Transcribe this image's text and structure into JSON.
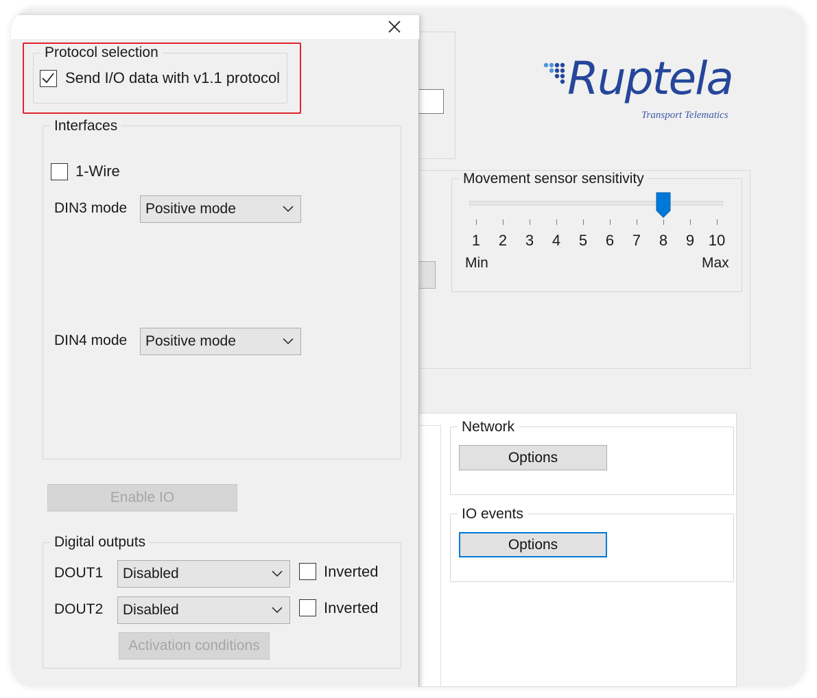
{
  "dialog": {
    "protocol_group": {
      "legend": "Protocol selection",
      "checkbox_label": "Send I/O data with v1.1 protocol",
      "checked": true
    },
    "interfaces_group": {
      "legend": "Interfaces",
      "onewire_label": "1-Wire",
      "onewire_checked": false,
      "din3_label": "DIN3 mode",
      "din3_value": "Positive mode",
      "din4_label": "DIN4 mode",
      "din4_value": "Positive mode"
    },
    "enable_io_label": "Enable IO",
    "digital_outputs_group": {
      "legend": "Digital outputs",
      "dout1_label": "DOUT1",
      "dout1_value": "Disabled",
      "dout1_inverted_label": "Inverted",
      "dout2_label": "DOUT2",
      "dout2_value": "Disabled",
      "dout2_inverted_label": "Inverted",
      "activation_label": "Activation conditions"
    }
  },
  "main": {
    "logo": {
      "name": "Ruptela",
      "tagline": "Transport Telematics",
      "color": "#25469a"
    },
    "movement_sensor": {
      "legend": "Movement sensor sensitivity",
      "ticks": [
        "1",
        "2",
        "3",
        "4",
        "5",
        "6",
        "7",
        "8",
        "9",
        "10"
      ],
      "value": 8,
      "min_label": "Min",
      "max_label": "Max"
    },
    "network": {
      "legend": "Network",
      "options_label": "Options"
    },
    "io_events": {
      "legend": "IO events",
      "options_label": "Options"
    }
  },
  "colors": {
    "accent": "#0078d7",
    "highlight": "#e0242b"
  }
}
